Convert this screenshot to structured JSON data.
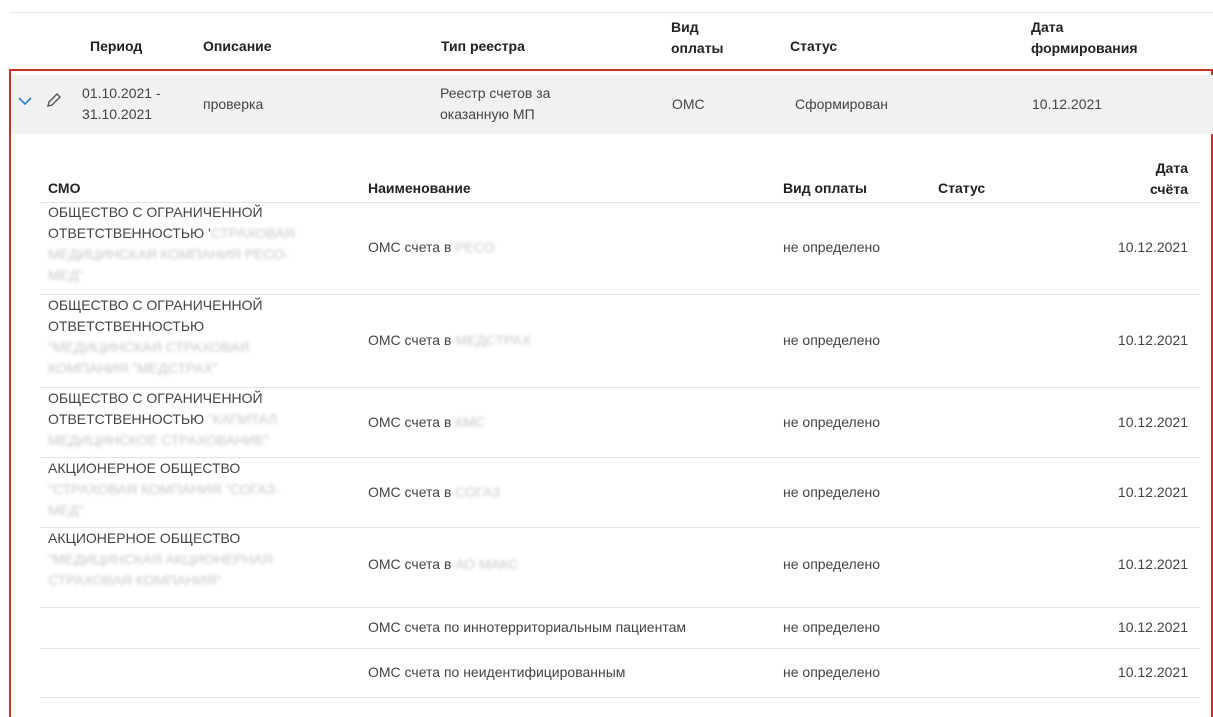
{
  "registry_header": {
    "period": "Период",
    "description": "Описание",
    "type": "Тип реестра",
    "payment_line1": "Вид",
    "payment_line2": "оплаты",
    "status": "Статус",
    "date_line1": "Дата",
    "date_line2": "формирования"
  },
  "registry_row": {
    "period_line1": "01.10.2021 -",
    "period_line2": "31.10.2021",
    "description": "проверка",
    "type_line1": "Реестр счетов за",
    "type_line2": "оказанную МП",
    "payment": "ОМС",
    "status": "Сформирован",
    "date": "10.12.2021"
  },
  "details_header": {
    "smo": "СМО",
    "name": "Наименование",
    "payment": "Вид оплаты",
    "status": "Статус",
    "date_line1": "Дата",
    "date_line2": "счёта"
  },
  "details_rows": [
    {
      "smo_l1": "ОБЩЕСТВО С ОГРАНИЧЕННОЙ",
      "smo_l2": "ОТВЕТСТВЕННОСТЬЮ '",
      "smo_l2_blur": "СТРАХОВАЯ",
      "smo_l3": "МЕДИЦИНСКАЯ КОМПАНИЯ РЕСО-",
      "smo_l4": "МЕД\"",
      "name": "ОМС счета в ",
      "name_blur": "РЕСО",
      "payment": "не определено",
      "date": "10.12.2021"
    },
    {
      "smo_l1": "ОБЩЕСТВО С ОГРАНИЧЕННОЙ",
      "smo_l2": "ОТВЕТСТВЕННОСТЬЮ",
      "smo_l2_blur": "",
      "smo_l3": "\"МЕДИЦИНСКАЯ СТРАХОВАЯ",
      "smo_l4": "КОМПАНИЯ \"МЕДСТРАХ\"",
      "name": "ОМС счета в ",
      "name_blur": "МЕДСТРАХ",
      "payment": "не определено",
      "date": "10.12.2021"
    },
    {
      "smo_l1": "ОБЩЕСТВО С ОГРАНИЧЕННОЙ",
      "smo_l2": "ОТВЕТСТВЕННОСТЬЮ",
      "smo_l2_blur": "\"КАПИТАЛ",
      "smo_l3": "МЕДИЦИНСКОЕ СТРАХОВАНИЕ\"",
      "name": "ОМС счета в ",
      "name_blur": "КМС",
      "payment": "не определено",
      "date": "10.12.2021"
    },
    {
      "smo_l1": "АКЦИОНЕРНОЕ ОБЩЕСТВО",
      "smo_l2": "\"СТРАХОВАЯ КОМПАНИЯ \"СОГАЗ-",
      "smo_l3": "МЕД\"",
      "name": "ОМС счета в ",
      "name_blur": "СОГАЗ",
      "payment": "не определено",
      "date": "10.12.2021"
    },
    {
      "smo_l1": "АКЦИОНЕРНОЕ ОБЩЕСТВО",
      "smo_l2": "\"МЕДИЦИНСКАЯ АКЦИОНЕРНАЯ",
      "smo_l3": "СТРАХОВАЯ КОМПАНИЯ\"",
      "name": "ОМС счета в ",
      "name_blur": "АО МАКС",
      "payment": "не определено",
      "date": "10.12.2021"
    },
    {
      "name": "ОМС счета по иннотерриториальным пациентам",
      "payment": "не определено",
      "date": "10.12.2021"
    },
    {
      "name": "ОМС счета по неидентифицированным",
      "payment": "не определено",
      "date": "10.12.2021"
    }
  ],
  "icons": {
    "expand": "chevron-down-icon",
    "edit": "pencil-icon"
  },
  "colors": {
    "frame": "#c9302c",
    "row_bg": "#f0f1f3",
    "chevron": "#2f7dd1"
  }
}
